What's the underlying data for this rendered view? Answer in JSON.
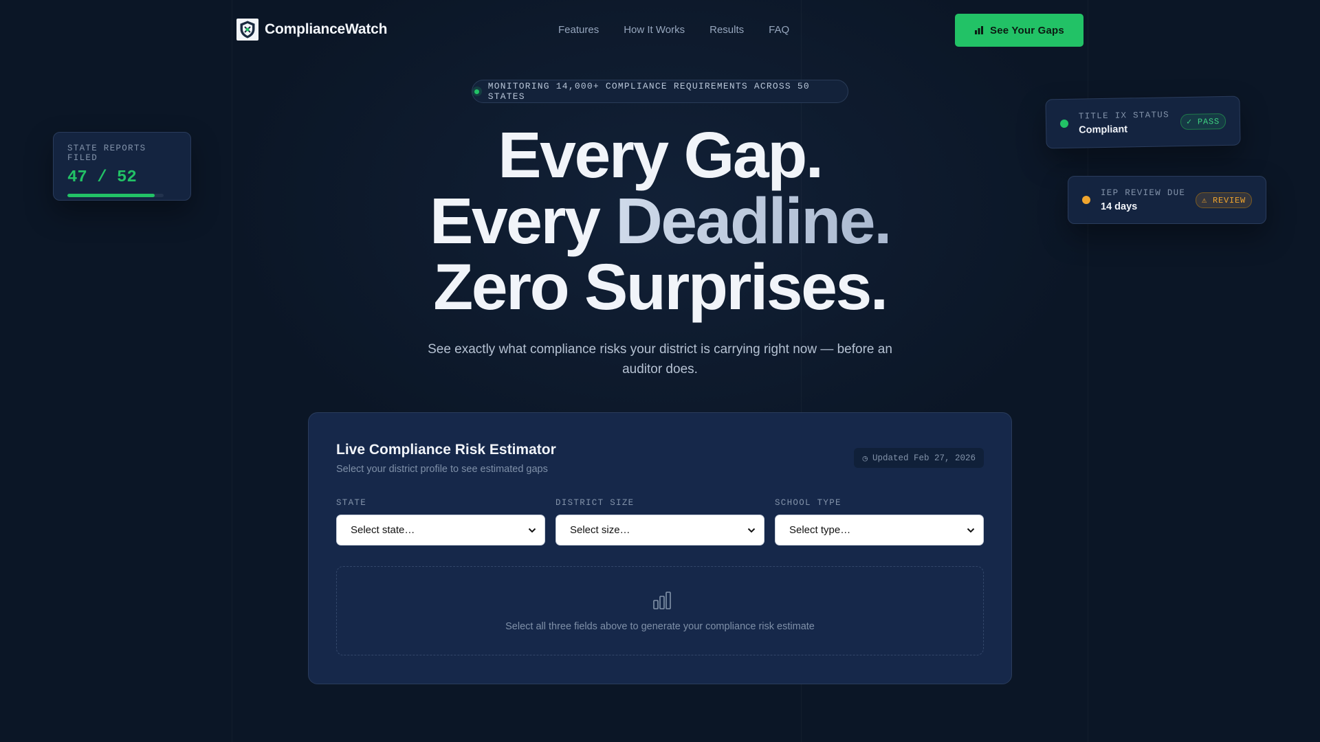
{
  "nav": {
    "brand": "ComplianceWatch",
    "links": [
      "Features",
      "How It Works",
      "Results",
      "FAQ"
    ],
    "cta_label": "See Your Gaps",
    "cta_icon": "bar-chart-icon"
  },
  "hero": {
    "pill": "MONITORING 14,000+ COMPLIANCE REQUIREMENTS ACROSS 50 STATES",
    "line1": "Every Gap.",
    "line2_a": "Every ",
    "line2_b": "Deadline.",
    "line3": "Zero Surprises.",
    "subtitle": "See exactly what compliance risks your district is carrying right now — before an auditor does."
  },
  "cards": {
    "reports": {
      "label": "STATE REPORTS FILED",
      "value": "47 / 52",
      "progress_fraction": 0.904
    },
    "title_ix": {
      "label": "TITLE IX STATUS",
      "value": "Compliant",
      "badge": "✓ PASS",
      "dot_color": "#22c266"
    },
    "iep": {
      "label": "IEP REVIEW DUE",
      "value": "14 days",
      "badge": "⚠ REVIEW",
      "dot_color": "#f0a52e"
    }
  },
  "estimator": {
    "title": "Live Compliance Risk Estimator",
    "subtitle": "Select your district profile to see estimated gaps",
    "updated": "Updated Feb 27, 2026",
    "fields": [
      {
        "label": "STATE",
        "placeholder": "Select state…"
      },
      {
        "label": "DISTRICT SIZE",
        "placeholder": "Select size…"
      },
      {
        "label": "SCHOOL TYPE",
        "placeholder": "Select type…"
      }
    ],
    "empty_message": "Select all three fields above to generate your compliance risk estimate"
  },
  "colors": {
    "background": "#0b1626",
    "accent": "#22c266",
    "warning": "#f0a52e",
    "panel": "#16284a"
  }
}
